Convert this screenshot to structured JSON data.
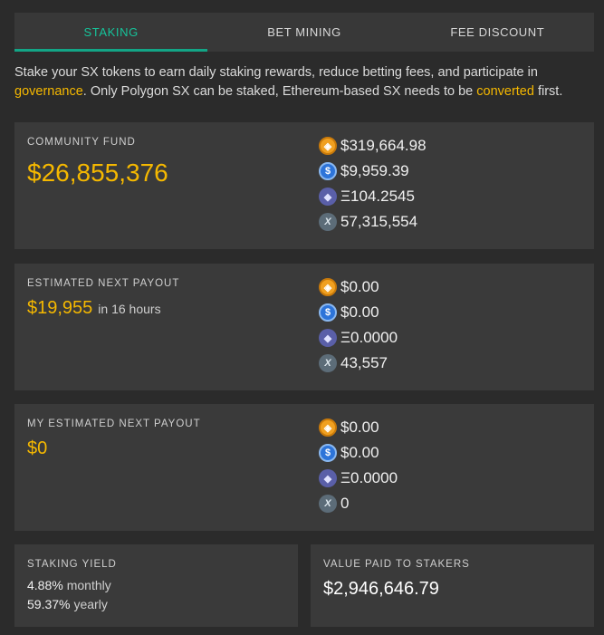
{
  "tabs": [
    {
      "label": "STAKING",
      "active": true
    },
    {
      "label": "BET MINING",
      "active": false
    },
    {
      "label": "FEE DISCOUNT",
      "active": false
    }
  ],
  "intro": {
    "part1": "Stake your SX tokens to earn daily staking rewards, reduce betting fees, and participate in ",
    "link1": "governance",
    "part2": ". Only Polygon SX can be staked, Ethereum-based SX needs to be ",
    "link2": "converted",
    "part3": " first."
  },
  "community_fund": {
    "label": "COMMUNITY FUND",
    "total": "$26,855,376",
    "coins": [
      {
        "icon": "dai-icon",
        "value": "$319,664.98"
      },
      {
        "icon": "usdc-icon",
        "value": "$9,959.39"
      },
      {
        "icon": "eth-icon",
        "value": "Ξ104.2545"
      },
      {
        "icon": "sx-icon",
        "value": "57,315,554"
      }
    ]
  },
  "next_payout": {
    "label": "ESTIMATED NEXT PAYOUT",
    "total": "$19,955",
    "when": "in 16 hours",
    "coins": [
      {
        "icon": "dai-icon",
        "value": "$0.00"
      },
      {
        "icon": "usdc-icon",
        "value": "$0.00"
      },
      {
        "icon": "eth-icon",
        "value": "Ξ0.0000"
      },
      {
        "icon": "sx-icon",
        "value": "43,557"
      }
    ]
  },
  "my_payout": {
    "label": "MY ESTIMATED NEXT PAYOUT",
    "total": "$0",
    "coins": [
      {
        "icon": "dai-icon",
        "value": "$0.00"
      },
      {
        "icon": "usdc-icon",
        "value": "$0.00"
      },
      {
        "icon": "eth-icon",
        "value": "Ξ0.0000"
      },
      {
        "icon": "sx-icon",
        "value": "0"
      }
    ]
  },
  "staking_yield": {
    "label": "STAKING YIELD",
    "monthly_value": "4.88%",
    "monthly_unit": "monthly",
    "yearly_value": "59.37%",
    "yearly_unit": "yearly"
  },
  "value_paid": {
    "label": "VALUE PAID TO STAKERS",
    "value": "$2,946,646.79"
  },
  "colors": {
    "accent": "#16c39a",
    "highlight": "#f5b800",
    "background": "#2b2b2b",
    "card": "#3a3a3a"
  }
}
